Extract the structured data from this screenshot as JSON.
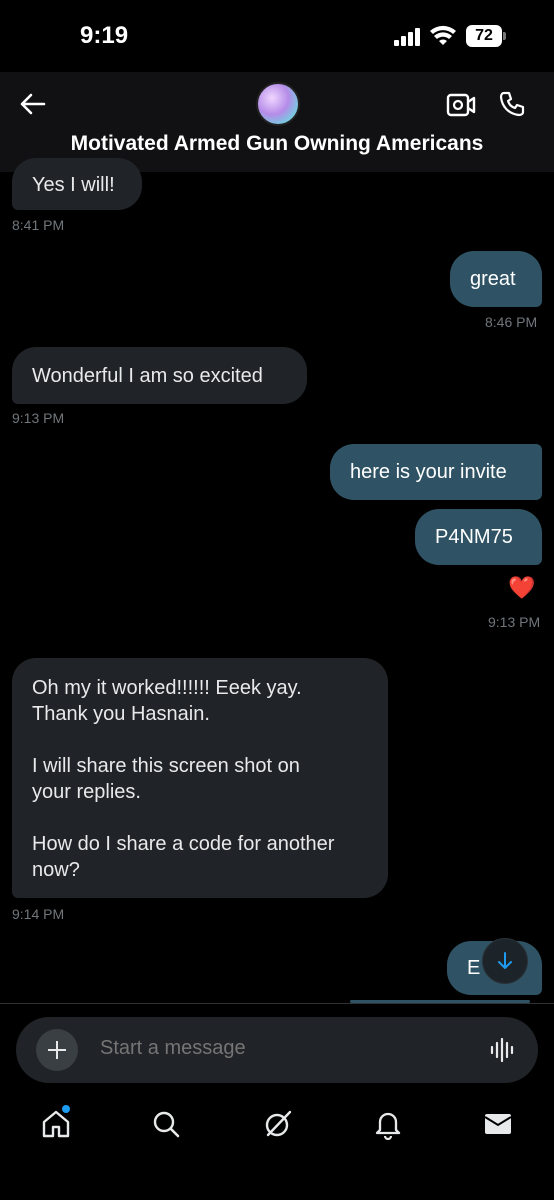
{
  "status_bar": {
    "time": "9:19",
    "battery": "72"
  },
  "header": {
    "title": "Motivated Armed Gun Owning Americans"
  },
  "messages": [
    {
      "side": "in",
      "text": "Yes I will!",
      "time": "8:41 PM"
    },
    {
      "side": "out",
      "text": "great",
      "time": "8:46 PM"
    },
    {
      "side": "in",
      "text": "Wonderful I am so excited",
      "time": "9:13 PM"
    },
    {
      "side": "out",
      "text": "here is your invite"
    },
    {
      "side": "out",
      "text": "P4NM75",
      "reaction": "❤️",
      "time": "9:13 PM"
    },
    {
      "side": "in",
      "text": "Oh my it worked!!!!!! Eeek yay.\nThank you Hasnain.\n\nI will share this screen shot on\nyour replies.\n\nHow do I share a code for another\nnow?",
      "time": "9:14 PM"
    },
    {
      "side": "out",
      "text": "E"
    }
  ],
  "composer": {
    "placeholder": "Start a message"
  },
  "icons": {
    "back": "back-arrow-icon",
    "video": "video-call-icon",
    "call": "phone-icon",
    "add": "plus-icon",
    "voice": "voice-wave-icon",
    "scroll": "arrow-down-icon",
    "home": "home-icon",
    "search": "search-icon",
    "grok": "grok-icon",
    "notifications": "bell-icon",
    "messages": "envelope-icon"
  },
  "colors": {
    "background": "#000000",
    "incoming_bubble": "#202327",
    "outgoing_bubble": "#2f5364",
    "accent": "#1d9bf0"
  }
}
